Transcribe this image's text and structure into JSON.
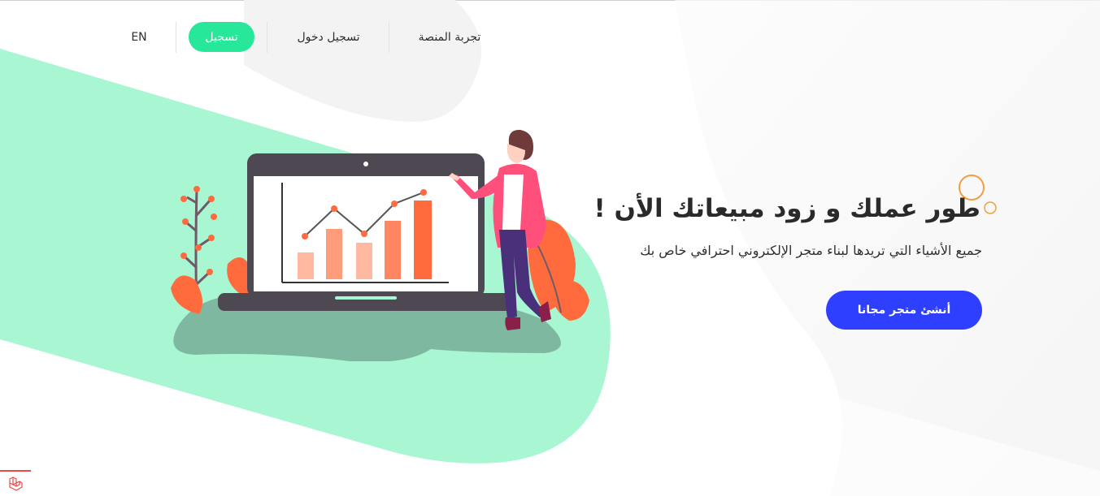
{
  "nav": {
    "lang_label": "EN",
    "register_label": "تسجيل",
    "login_label": "تسجيل دخول",
    "demo_label": "تجربة المنصة"
  },
  "hero": {
    "title": "طور عملك و زود مبيعاتك الأن !",
    "subtitle": "جميع الأشياء التي تريدها لبناء متجر الإلكتروني احترافي خاص بك",
    "cta_label": "أنشئ متجر مجانا"
  },
  "colors": {
    "accent_green": "#27e89a",
    "bg_mint": "#a8f7d2",
    "cta_blue": "#2f3fff",
    "chart_orange": "#ff6b3d",
    "ring_orange": "#f0a040"
  },
  "icons": {
    "corner": "laravel-logo-icon",
    "ring": "decorative-ring-icon"
  }
}
